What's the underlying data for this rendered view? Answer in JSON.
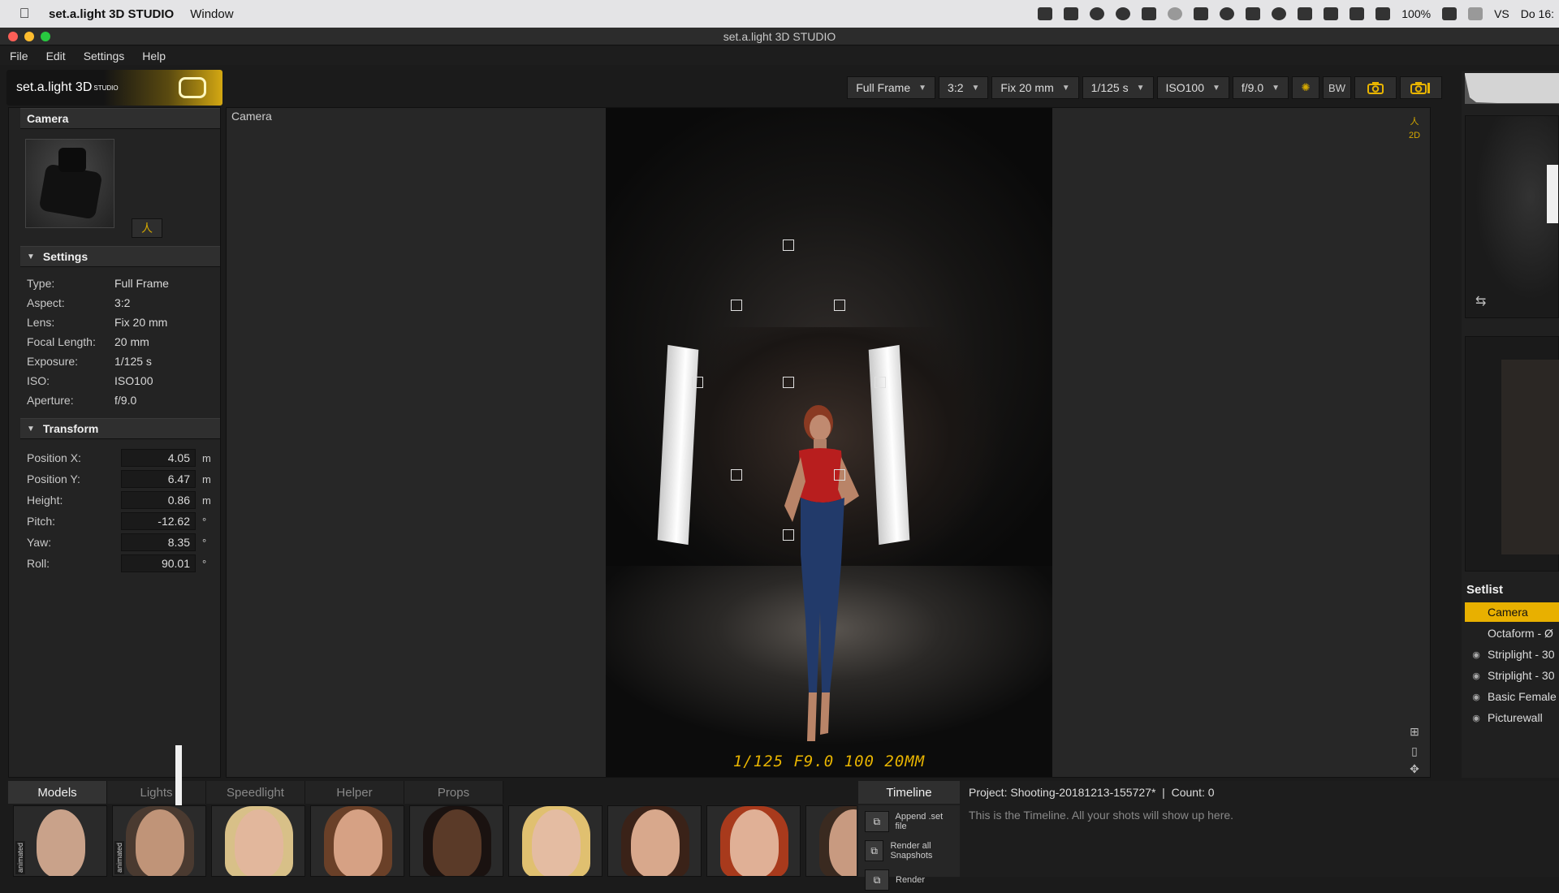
{
  "mac_menubar": {
    "app": "set.a.light 3D STUDIO",
    "window_menu": "Window",
    "battery": "100%",
    "lang": "VS",
    "clock": "Do 16:"
  },
  "window": {
    "title": "set.a.light 3D STUDIO"
  },
  "app_menu": [
    "File",
    "Edit",
    "Settings",
    "Help"
  ],
  "logo": {
    "text": "set.a.light 3D",
    "sup": "STUDIO"
  },
  "toolbar": {
    "sensor": "Full Frame",
    "aspect": "3:2",
    "lens": "Fix 20 mm",
    "shutter": "1/125 s",
    "iso": "ISO100",
    "aperture": "f/9.0",
    "bw": "BW"
  },
  "camera_panel": {
    "title": "Camera",
    "settings_title": "Settings",
    "settings": [
      {
        "k": "Type:",
        "v": "Full Frame"
      },
      {
        "k": "Aspect:",
        "v": "3:2"
      },
      {
        "k": "Lens:",
        "v": "Fix 20 mm"
      },
      {
        "k": "Focal Length:",
        "v": "20 mm"
      },
      {
        "k": "Exposure:",
        "v": "1/125 s"
      },
      {
        "k": "ISO:",
        "v": "ISO100"
      },
      {
        "k": "Aperture:",
        "v": "f/9.0"
      }
    ],
    "transform_title": "Transform",
    "transform": [
      {
        "k": "Position X:",
        "v": "4.05",
        "unit": "m"
      },
      {
        "k": "Position Y:",
        "v": "6.47",
        "unit": "m"
      },
      {
        "k": "Height:",
        "v": "0.86",
        "unit": "m"
      },
      {
        "k": "Pitch:",
        "v": "-12.62",
        "unit": "°"
      },
      {
        "k": "Yaw:",
        "v": "8.35",
        "unit": "°"
      },
      {
        "k": "Roll:",
        "v": "90.01",
        "unit": "°"
      }
    ]
  },
  "viewport": {
    "label": "Camera",
    "readout": "1/125  F9.0  100  20MM",
    "tool_2d": "2D"
  },
  "setlist": {
    "title": "Setlist",
    "items": [
      {
        "label": "Camera",
        "active": true
      },
      {
        "label": "Octaform - Ø",
        "active": false
      },
      {
        "label": "Striplight - 30",
        "active": false
      },
      {
        "label": "Striplight - 30",
        "active": false
      },
      {
        "label": "Basic Female",
        "active": false
      },
      {
        "label": "Picturewall",
        "active": false
      }
    ]
  },
  "bottom_tabs": [
    "Models",
    "Lights",
    "Speedlight",
    "Helper",
    "Props"
  ],
  "models": [
    {
      "tag": "animated",
      "skin": "#c9a28a",
      "hair": "none"
    },
    {
      "tag": "animated",
      "skin": "#c09478",
      "hair": "#4a3a30"
    },
    {
      "tag": "",
      "skin": "#e2b79c",
      "hair": "#d8c088"
    },
    {
      "tag": "",
      "skin": "#d6a184",
      "hair": "#6a4028"
    },
    {
      "tag": "",
      "skin": "#5a3a28",
      "hair": "#1a1210"
    },
    {
      "tag": "",
      "skin": "#e4bca2",
      "hair": "#e0c070"
    },
    {
      "tag": "",
      "skin": "#d8a88c",
      "hair": "#3a2218"
    },
    {
      "tag": "",
      "skin": "#e0b096",
      "hair": "#a83a1c"
    },
    {
      "tag": "",
      "skin": "#c89a80",
      "hair": "#3a2a20"
    }
  ],
  "timeline": {
    "tab": "Timeline",
    "project": "Project: Shooting-20181213-155727*",
    "count": "Count: 0",
    "hint": "This is the Timeline. All your shots will show up here.",
    "append_label": "Append .set file",
    "render_all_label": "Render all Snapshots",
    "render_label": "Render"
  }
}
